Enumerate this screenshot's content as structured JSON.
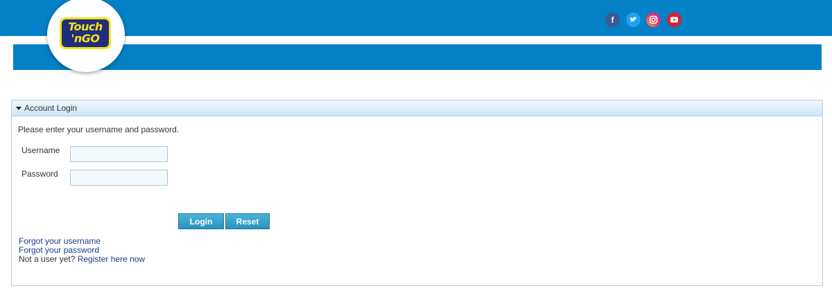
{
  "header": {
    "logo_line1": "Touch",
    "logo_line2": "'nGO",
    "social": [
      {
        "name": "facebook-icon",
        "color": "#3b5998"
      },
      {
        "name": "twitter-icon",
        "color": "#1da1f2"
      },
      {
        "name": "instagram-icon",
        "color": "#e1306c"
      },
      {
        "name": "youtube-icon",
        "color": "#d8202e"
      }
    ],
    "brand_color": "#0480c6"
  },
  "login": {
    "panel_title": "Account Login",
    "intro": "Please enter your username and password.",
    "username_label": "Username",
    "password_label": "Password",
    "username_value": "",
    "password_value": "",
    "login_button": "Login",
    "reset_button": "Reset",
    "forgot_username": "Forgot your username",
    "forgot_password": "Forgot your password",
    "not_user": "Not a user yet?",
    "register": "Register here now"
  }
}
